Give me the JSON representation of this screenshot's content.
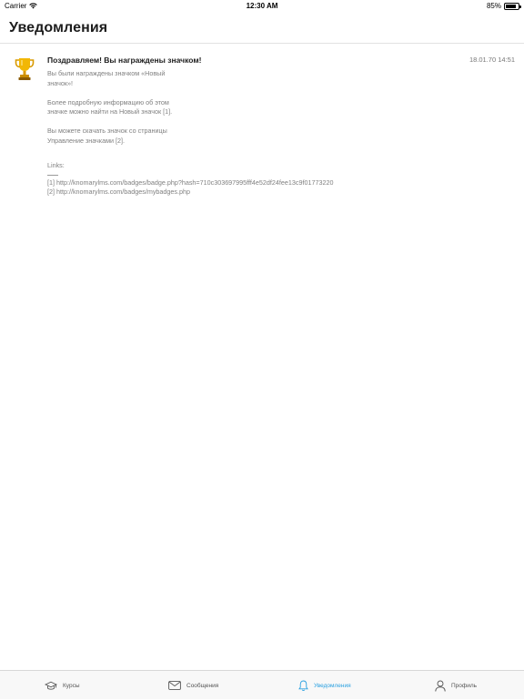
{
  "status_bar": {
    "carrier": "Carrier",
    "time": "12:30 AM",
    "battery": "85%",
    "battery_level": 0.85
  },
  "header": {
    "title": "Уведомления"
  },
  "notification": {
    "icon": "trophy-icon",
    "title": "Поздравляем! Вы награждены значком!",
    "timestamp": "18.01.70 14:51",
    "body": {
      "p1_line1": "Вы были награждены значком «Новый",
      "p1_line2": "значок»!",
      "p2_line1": "Более подробную информацию об этом",
      "p2_line2": "значке можно найти на Новый значок [1].",
      "p3_line1": "Вы можете скачать значок со страницы",
      "p3_line2": "Управление значками [2].",
      "links_label": "Links:",
      "link1": "[1] http://knomarylms.com/badges/badge.php?hash=710c303697995fff4e52df24fee13c9f01773220",
      "link2": "[2] http://knomarylms.com/badges/mybadges.php"
    }
  },
  "tab_bar": {
    "accent_color": "#2aa0e0",
    "tabs": [
      {
        "label": "Курсы",
        "icon": "graduation-cap-icon"
      },
      {
        "label": "Сообщения",
        "icon": "envelope-icon"
      },
      {
        "label": "Уведомления",
        "icon": "bell-icon",
        "active": true
      },
      {
        "label": "Профиль",
        "icon": "user-icon"
      }
    ]
  }
}
